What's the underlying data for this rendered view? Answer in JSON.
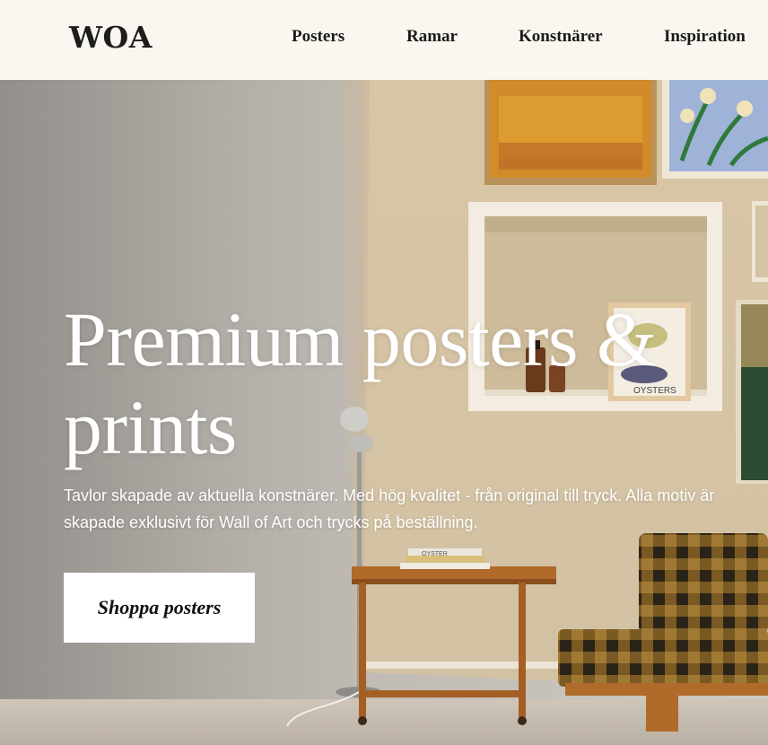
{
  "header": {
    "logo": "WOA",
    "nav": [
      {
        "label": "Posters"
      },
      {
        "label": "Ramar"
      },
      {
        "label": "Konstnärer"
      },
      {
        "label": "Inspiration"
      }
    ]
  },
  "hero": {
    "title": "Premium posters & prints",
    "subtitle": "Tavlor skapade av aktuella konstnärer. Med hög kvalitet - från original till tryck. Alla motiv är skapade exklusivt för Wall of Art och trycks på beställning.",
    "cta_label": "Shoppa posters",
    "book_spine_text": "OYSTER",
    "poster_text": "OYSTERS"
  },
  "colors": {
    "header_bg": "#faf6f0",
    "text_dark": "#1a1a1a",
    "hero_text": "#ffffff",
    "cta_bg": "#ffffff"
  }
}
